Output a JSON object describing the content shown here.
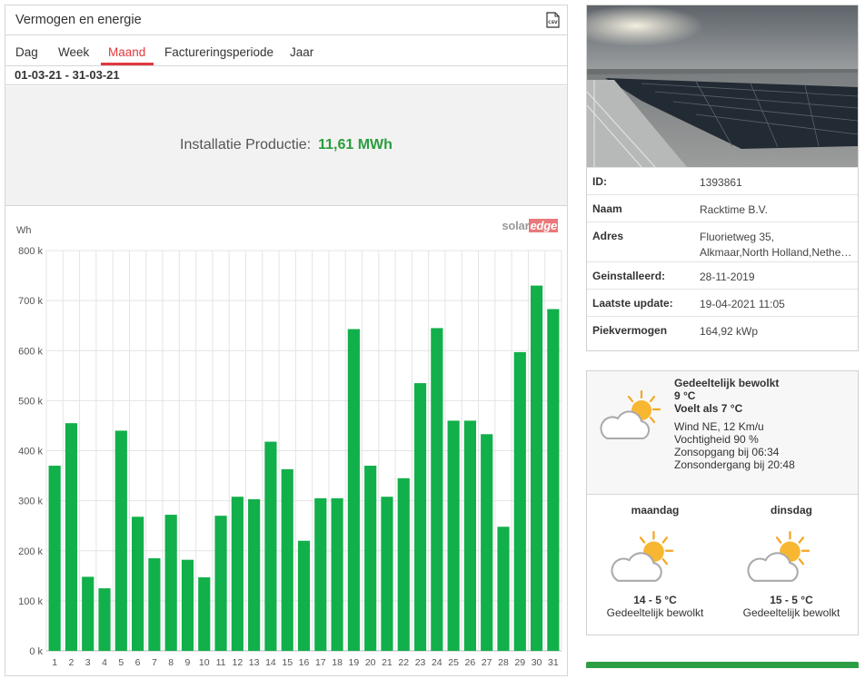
{
  "panel": {
    "title": "Vermogen en energie",
    "csv_icon": "csv-export-icon",
    "tabs": [
      "Dag",
      "Week",
      "Maand",
      "Factureringsperiode",
      "Jaar"
    ],
    "active_tab": "Maand",
    "date_range": "01-03-21 - 31-03-21",
    "production_label": "Installatie Productie:",
    "production_value": "11,61 MWh",
    "logo_solar": "solar",
    "logo_edge": "edge"
  },
  "colors": {
    "accent_red": "#e0393e",
    "bar_green": "#11b04a",
    "value_green": "#2a9d3e"
  },
  "chart_data": {
    "type": "bar",
    "ylabel": "Wh",
    "ylim": [
      0,
      800000
    ],
    "yticks": [
      "0 k",
      "100 k",
      "200 k",
      "300 k",
      "400 k",
      "500 k",
      "600 k",
      "700 k",
      "800 k"
    ],
    "categories": [
      "1",
      "2",
      "3",
      "4",
      "5",
      "6",
      "7",
      "8",
      "9",
      "10",
      "11",
      "12",
      "13",
      "14",
      "15",
      "16",
      "17",
      "18",
      "19",
      "20",
      "21",
      "22",
      "23",
      "24",
      "25",
      "26",
      "27",
      "28",
      "29",
      "30",
      "31"
    ],
    "values": [
      370000,
      455000,
      148000,
      125000,
      440000,
      268000,
      185000,
      272000,
      182000,
      147000,
      270000,
      308000,
      303000,
      418000,
      363000,
      220000,
      305000,
      305000,
      643000,
      370000,
      308000,
      345000,
      535000,
      645000,
      460000,
      460000,
      433000,
      248000,
      597000,
      730000,
      683000
    ],
    "grid": true
  },
  "site": {
    "photo": "solar-roof-photo",
    "rows": [
      {
        "key": "ID:",
        "value": "1393861"
      },
      {
        "key": "Naam",
        "value": "Racktime B.V."
      },
      {
        "key": "Adres",
        "value": "Fluorietweg 35,",
        "value2": "Alkmaar,North Holland,Netherlands"
      },
      {
        "key": "Geinstalleerd:",
        "value": "28-11-2019"
      },
      {
        "key": "Laatste update:",
        "value": "19-04-2021 11:05"
      },
      {
        "key": "Piekvermogen",
        "value": "164,92 kWp"
      }
    ]
  },
  "weather": {
    "icon": "partly-cloudy-icon",
    "condition": "Gedeeltelijk bewolkt",
    "temp": "9 °C",
    "feels_like": "Voelt als 7 °C",
    "wind": "Wind NE, 12 Km/u",
    "humidity": "Vochtigheid 90 %",
    "sunrise": "Zonsopgang bij 06:34",
    "sunset": "Zonsondergang bij 20:48",
    "forecast": [
      {
        "day": "maandag",
        "temp": "14 - 5 °C",
        "condition": "Gedeeltelijk bewolkt"
      },
      {
        "day": "dinsdag",
        "temp": "15 - 5 °C",
        "condition": "Gedeeltelijk bewolkt"
      }
    ]
  }
}
